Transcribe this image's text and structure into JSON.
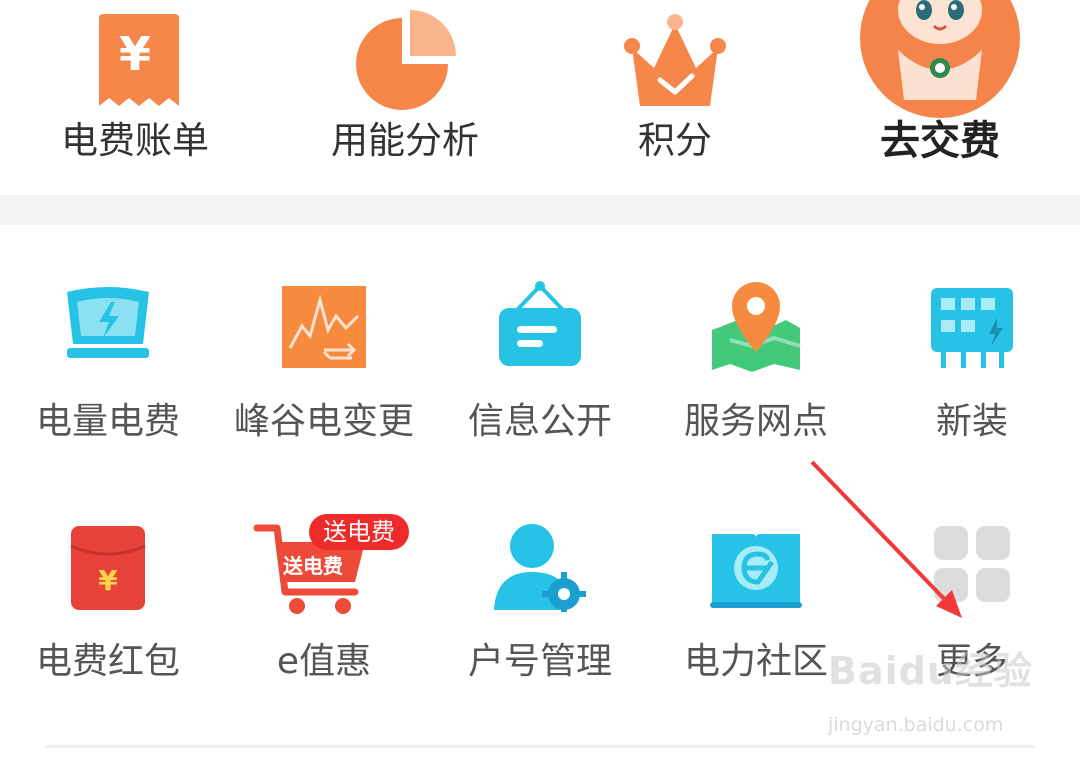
{
  "top": {
    "items": [
      {
        "label": "电费账单",
        "icon": "bill-receipt-icon"
      },
      {
        "label": "用能分析",
        "icon": "pie-chart-icon"
      },
      {
        "label": "积分",
        "icon": "crown-icon"
      },
      {
        "label": "去交费",
        "icon": "mascot-avatar"
      }
    ]
  },
  "grid": {
    "row1": [
      {
        "label": "电量电费",
        "icon": "monitor-lightning-icon"
      },
      {
        "label": "峰谷电变更",
        "icon": "peak-valley-chart-icon"
      },
      {
        "label": "信息公开",
        "icon": "notice-board-icon"
      },
      {
        "label": "服务网点",
        "icon": "map-pin-icon"
      },
      {
        "label": "新装",
        "icon": "new-install-panel-icon"
      }
    ],
    "row2": [
      {
        "label": "电费红包",
        "icon": "red-envelope-icon"
      },
      {
        "label": "e值惠",
        "icon": "shopping-cart-icon",
        "badge": "送电费",
        "cart_text": "送电费"
      },
      {
        "label": "户号管理",
        "icon": "user-gear-icon"
      },
      {
        "label": "电力社区",
        "icon": "community-book-icon"
      },
      {
        "label": "更多",
        "icon": "more-grid-icon"
      }
    ]
  },
  "watermark": {
    "brand": "Baidu经验",
    "url": "jingyan.baidu.com"
  },
  "colors": {
    "orange": "#f6874a",
    "cyan": "#27c3e6",
    "red": "#e6423a",
    "arrow": "#f03a3a"
  }
}
